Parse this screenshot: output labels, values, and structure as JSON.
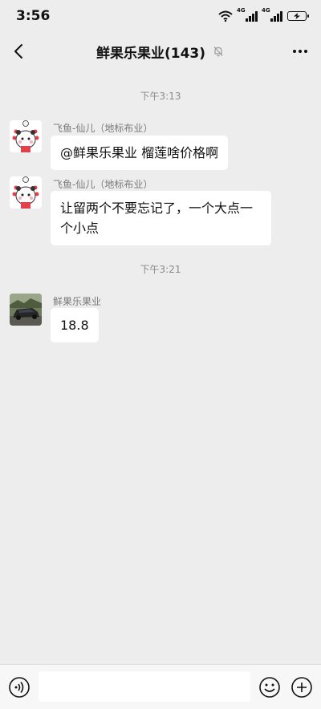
{
  "status_bar": {
    "time": "3:56",
    "network_1": "4G",
    "network_2": "4G",
    "icons": [
      "wifi-icon",
      "signal-icon",
      "signal-icon",
      "battery-charging-icon"
    ]
  },
  "header": {
    "title": "鲜果乐果业(143)",
    "back_icon": "chevron-left-icon",
    "mute_icon": "bell-off-icon",
    "more_icon": "more-dots-icon"
  },
  "messages": [
    {
      "type": "time",
      "text": "下午3:13"
    },
    {
      "type": "message",
      "sender": "飞鱼-仙儿（地标布业）",
      "text": "@鲜果乐果业  榴莲啥价格啊",
      "avatar": "panda-bear-avatar"
    },
    {
      "type": "message",
      "sender": "飞鱼-仙儿（地标布业）",
      "text_line1": "让留两个不要忘记了，一个大点一",
      "text_line2": "个小点",
      "avatar": "panda-bear-avatar"
    },
    {
      "type": "time",
      "text": "下午3:21"
    },
    {
      "type": "message",
      "sender": "鲜果乐果业",
      "text": "18.8",
      "avatar": "car-photo-avatar"
    }
  ],
  "input_bar": {
    "voice_icon": "voice-icon",
    "placeholder": "",
    "emoji_icon": "emoji-icon",
    "plus_icon": "plus-icon"
  },
  "colors": {
    "background": "#ededed",
    "bubble": "#ffffff",
    "secondary_text": "#8a8a8a"
  }
}
